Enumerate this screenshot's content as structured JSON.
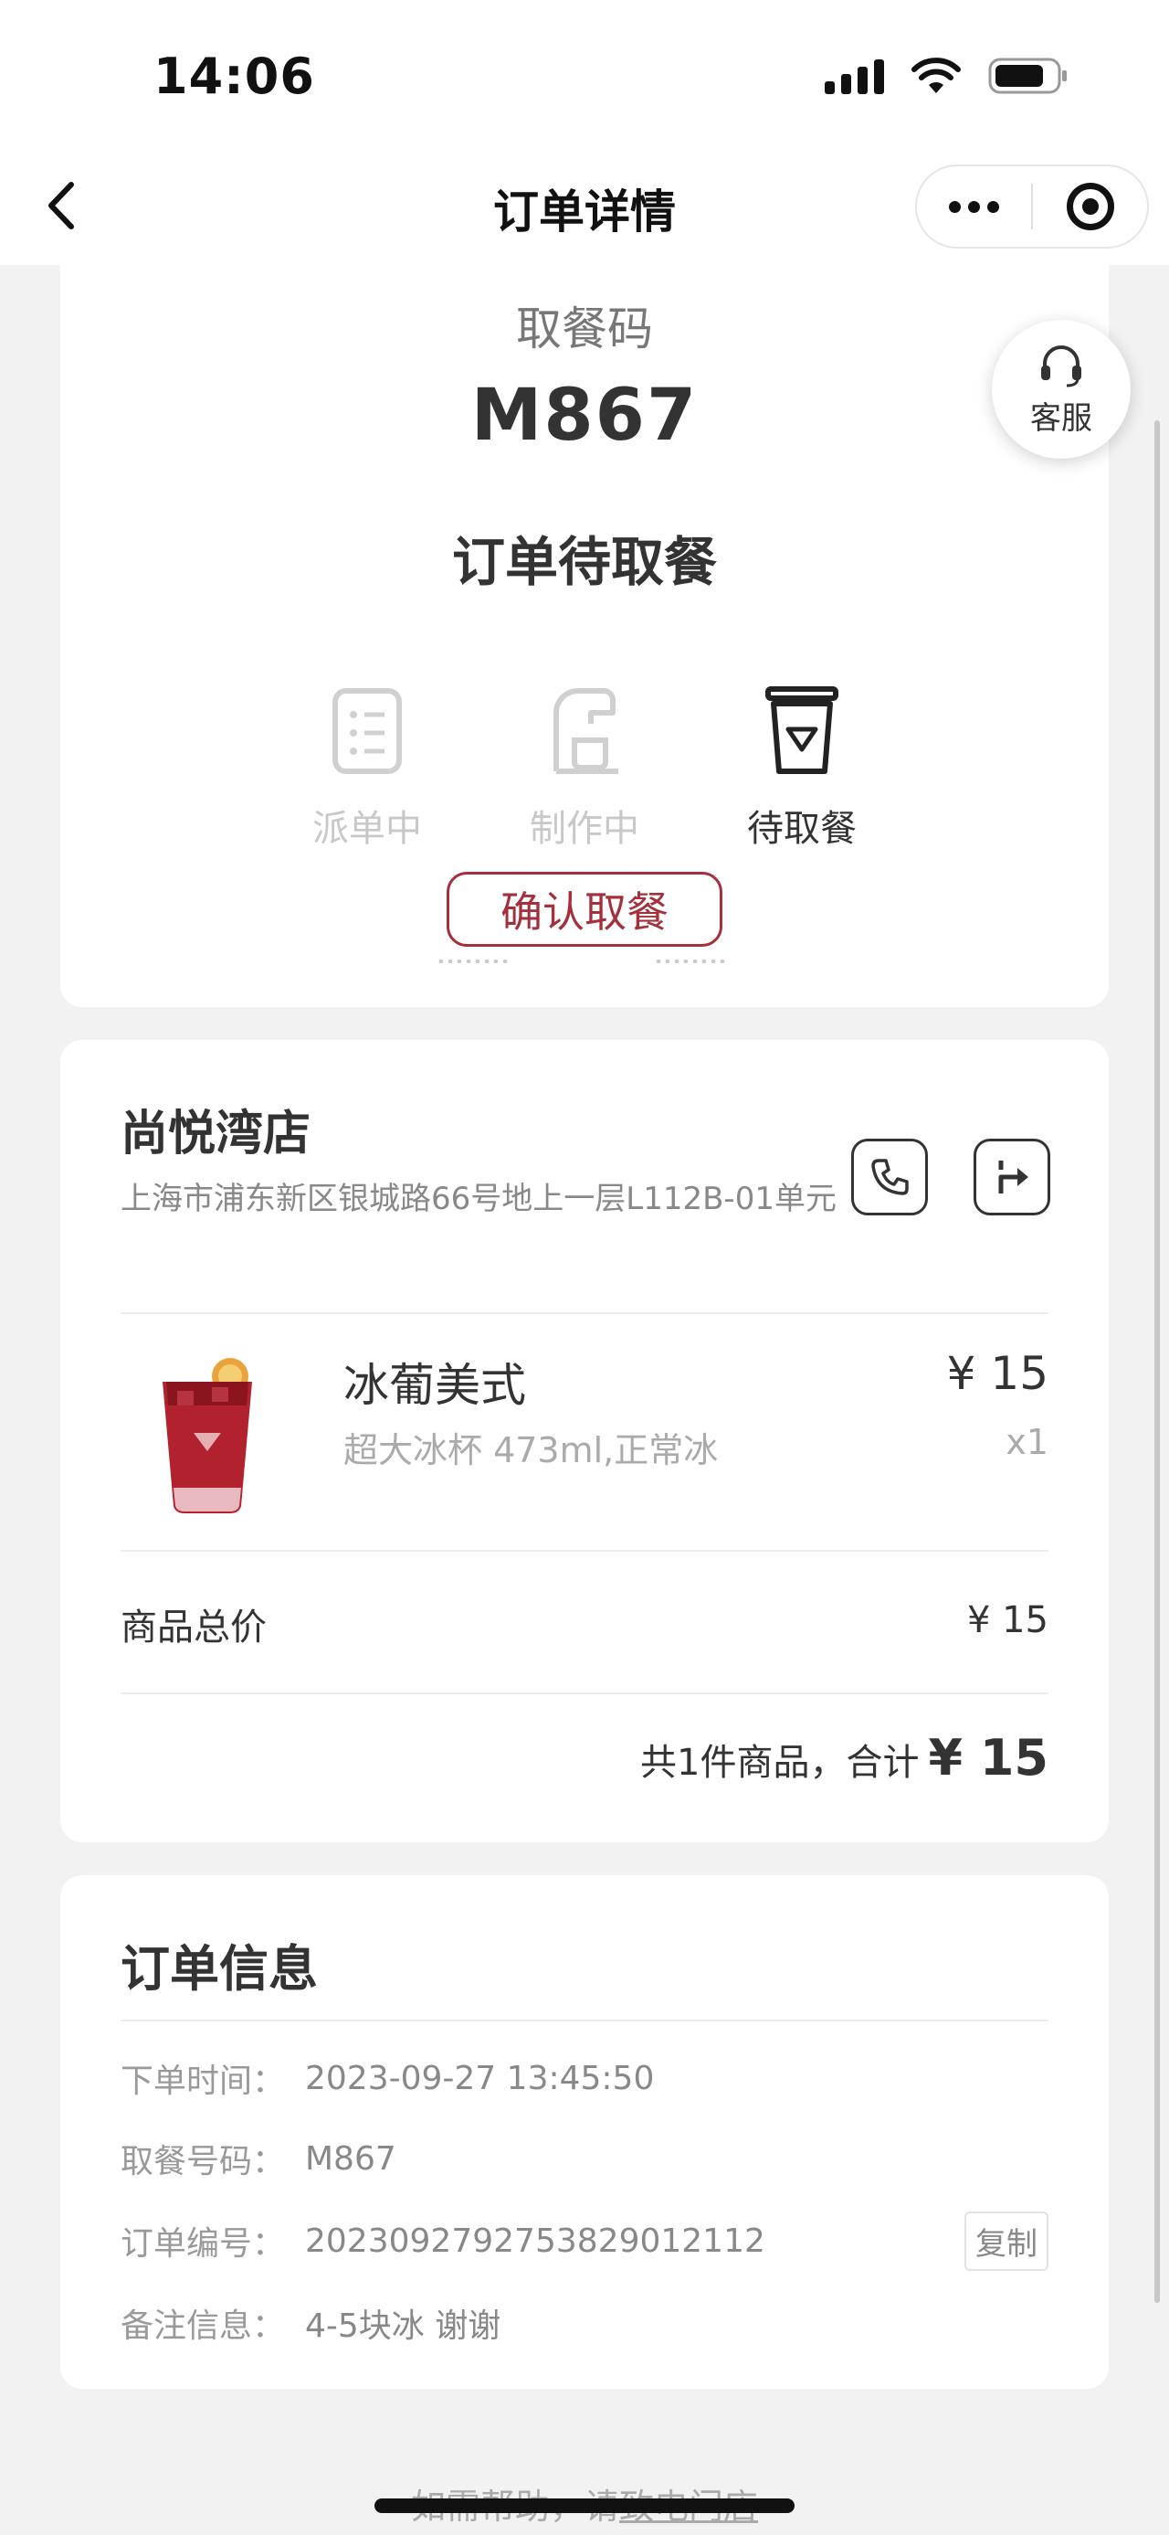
{
  "status_bar": {
    "time": "14:06"
  },
  "nav": {
    "title": "订单详情"
  },
  "pickup": {
    "label": "取餐码",
    "code": "M867",
    "status": "订单待取餐",
    "steps": [
      {
        "label": "派单中",
        "state": "done",
        "icon": "list-icon"
      },
      {
        "label": "制作中",
        "state": "done",
        "icon": "coffee-machine-icon"
      },
      {
        "label": "待取餐",
        "state": "active",
        "icon": "cup-icon"
      }
    ],
    "confirm_label": "确认取餐"
  },
  "customer_service": {
    "label": "客服",
    "icon": "headset-icon"
  },
  "store": {
    "name": "尚悦湾店",
    "address": "上海市浦东新区银城路66号地上一层L112B-01单元",
    "phone_icon": "phone-icon",
    "nav_icon": "directions-icon"
  },
  "product": {
    "name": "冰葡美式",
    "spec": "超大冰杯 473ml,正常冰",
    "price": "¥ 15",
    "qty": "x1"
  },
  "totals": {
    "label": "商品总价",
    "value": "¥ 15",
    "summary_text": "共1件商品，合计",
    "summary_amount": "¥ 15"
  },
  "order_info": {
    "title": "订单信息",
    "rows": [
      {
        "key": "下单时间：",
        "value": "2023-09-27 13:45:50"
      },
      {
        "key": "取餐号码：",
        "value": "M867"
      },
      {
        "key": "订单编号：",
        "value": "20230927927538290121​12"
      },
      {
        "key": "备注信息：",
        "value": "4-5块冰 谢谢"
      }
    ],
    "copy_label": "复制"
  },
  "footer": {
    "prefix": "如需帮助，请",
    "link": "致电门店"
  },
  "colors": {
    "accent": "#a3303a",
    "muted": "#c8c8c8",
    "background": "#f2f2f2"
  }
}
